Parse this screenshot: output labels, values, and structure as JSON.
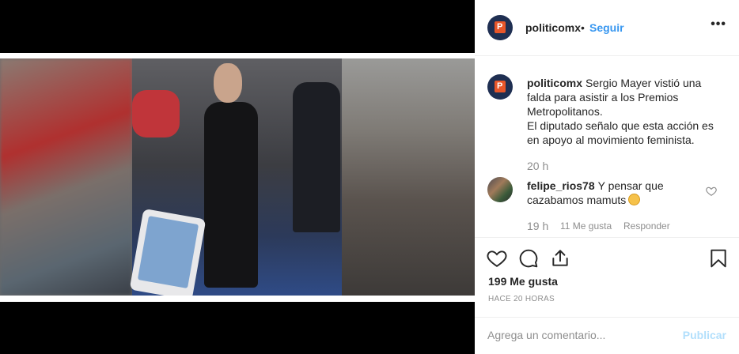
{
  "post": {
    "username": "politicomx",
    "dot": "•",
    "follow_label": "Seguir",
    "more_label": "•••",
    "avatar_letter": "P"
  },
  "caption": {
    "username": "politicomx",
    "line1": "Sergio Mayer vistió una falda para asistir a los Premios Metropolitanos.",
    "line2": "El diputado señalo que esta acción es en apoyo al movimiento feminista.",
    "time": "20 h"
  },
  "comment": {
    "username": "felipe_rios78",
    "text": "Y pensar que cazabamos mamuts",
    "time": "19 h",
    "likes": "11 Me gusta",
    "reply_label": "Responder"
  },
  "actions": {
    "likes_count": "199 Me gusta",
    "posted_ago": "HACE 20 HORAS"
  },
  "add_comment": {
    "placeholder": "Agrega un comentario...",
    "publish_label": "Publicar"
  },
  "colors": {
    "follow": "#3897f0",
    "publish_disabled": "#b2dffc",
    "meta": "#8e8e8e",
    "brand_orange": "#e8562a",
    "brand_navy": "#1f2f52"
  },
  "icons": [
    "heart-icon",
    "comment-icon",
    "share-icon",
    "bookmark-icon",
    "more-icon",
    "small-heart-icon"
  ]
}
